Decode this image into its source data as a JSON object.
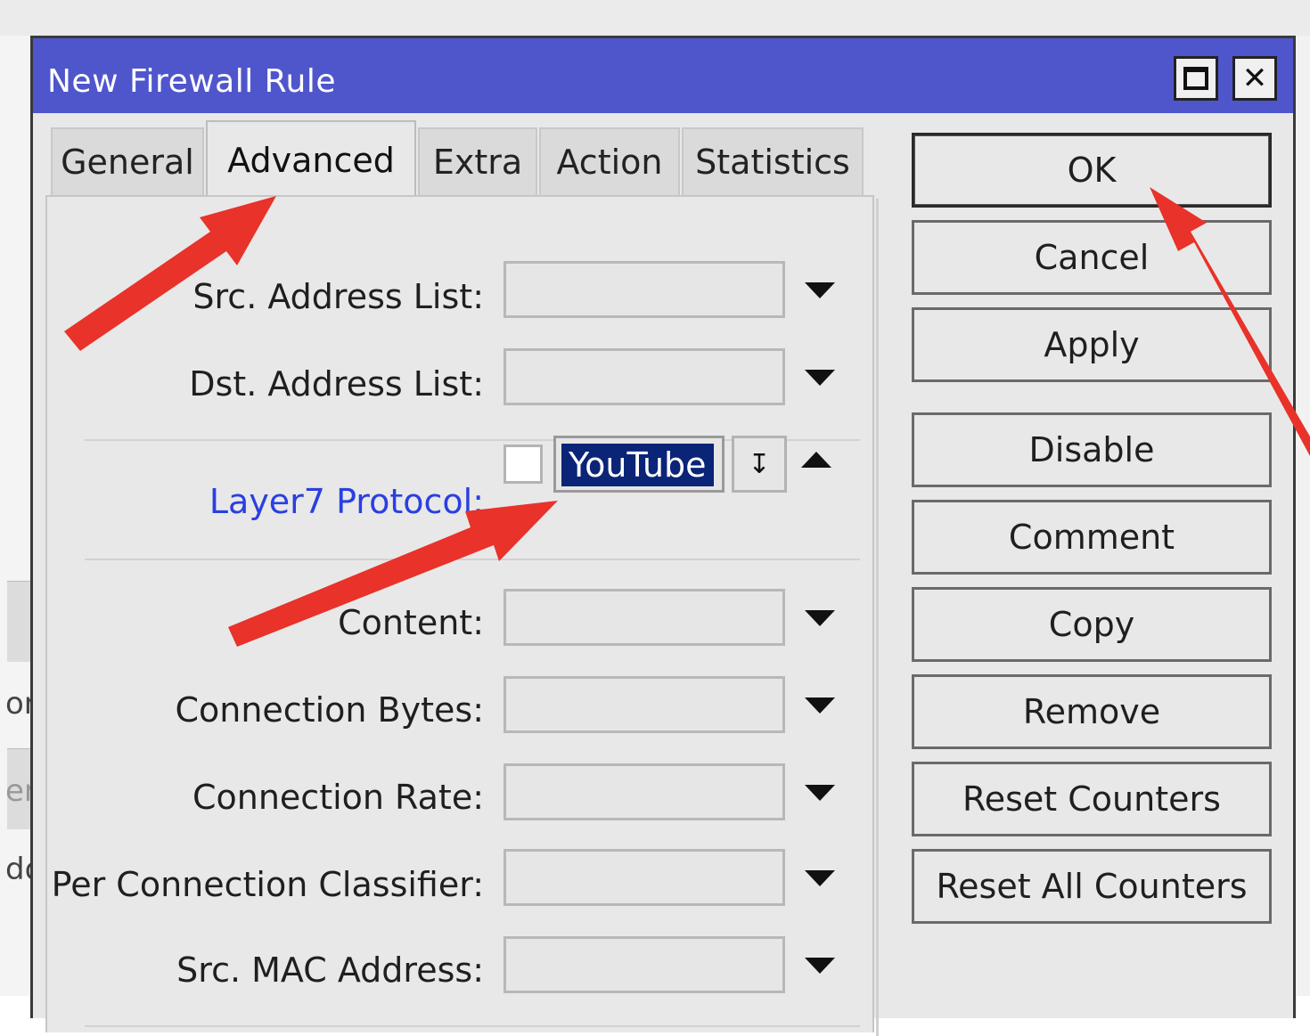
{
  "window": {
    "title": "New Firewall Rule"
  },
  "tabs": [
    {
      "label": "General",
      "active": false
    },
    {
      "label": "Advanced",
      "active": true
    },
    {
      "label": "Extra",
      "active": false
    },
    {
      "label": "Action",
      "active": false
    },
    {
      "label": "Statistics",
      "active": false
    }
  ],
  "fields": {
    "src_address_list": {
      "label": "Src. Address List:",
      "value": ""
    },
    "dst_address_list": {
      "label": "Dst. Address List:",
      "value": ""
    },
    "layer7_protocol": {
      "label": "Layer7 Protocol:",
      "value": "YouTube",
      "negate_checked": false
    },
    "content": {
      "label": "Content:",
      "value": ""
    },
    "connection_bytes": {
      "label": "Connection Bytes:",
      "value": ""
    },
    "connection_rate": {
      "label": "Connection Rate:",
      "value": ""
    },
    "per_connection_classifier": {
      "label": "Per Connection Classifier:",
      "value": ""
    },
    "src_mac_address": {
      "label": "Src. MAC Address:",
      "value": ""
    }
  },
  "buttons": {
    "ok": "OK",
    "cancel": "Cancel",
    "apply": "Apply",
    "disable": "Disable",
    "comment": "Comment",
    "copy": "Copy",
    "remove": "Remove",
    "reset_counters": "Reset Counters",
    "reset_all_counters": "Reset All Counters"
  },
  "background_window": {
    "fragments": [
      "or",
      "er",
      "do"
    ]
  },
  "colors": {
    "titlebar": "#4f56cc",
    "annotation_arrow": "#e8322a",
    "link_label": "#2a3fe0",
    "selection": "#0a2478"
  }
}
